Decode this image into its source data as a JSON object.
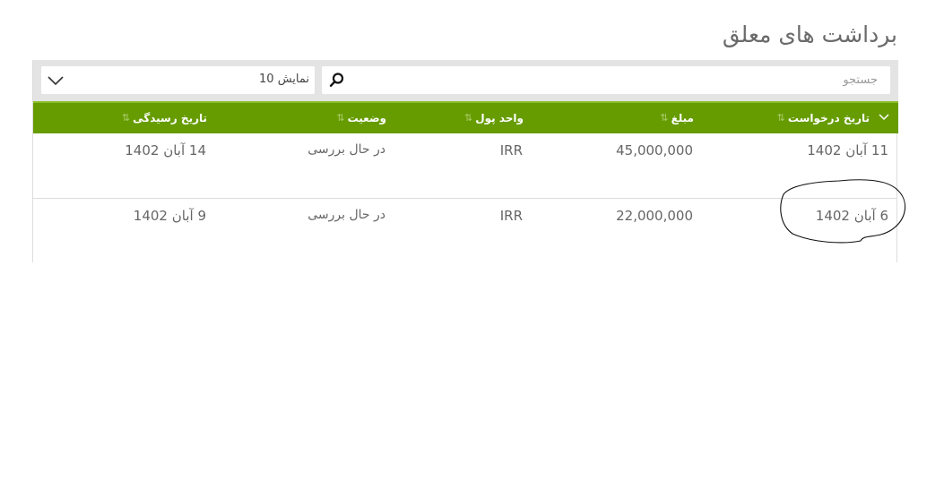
{
  "page": {
    "title": "برداشت های معلق"
  },
  "toolbar": {
    "search_placeholder": "جستجو",
    "search_icon": "search-icon",
    "page_size_label": "نمایش 10",
    "dropdown_icon": "chevron-down-icon"
  },
  "table": {
    "headers": [
      {
        "label": "تاریخ درخواست"
      },
      {
        "label": "مبلغ"
      },
      {
        "label": "واحد پول"
      },
      {
        "label": "وضعیت"
      },
      {
        "label": "تاریخ رسیدگی"
      }
    ],
    "rows": [
      {
        "request_date": "11 آبان 1402",
        "amount": "45,000,000",
        "currency": "IRR",
        "status": "در حال بررسی",
        "review_date": "14 آبان 1402"
      },
      {
        "request_date": "6 آبان 1402",
        "amount": "22,000,000",
        "currency": "IRR",
        "status": "در حال بررسی",
        "review_date": "9 آبان 1402"
      }
    ]
  },
  "colors": {
    "header_green": "#669c00",
    "toolbar_gray": "#e4e4e4",
    "text_gray": "#666666"
  }
}
